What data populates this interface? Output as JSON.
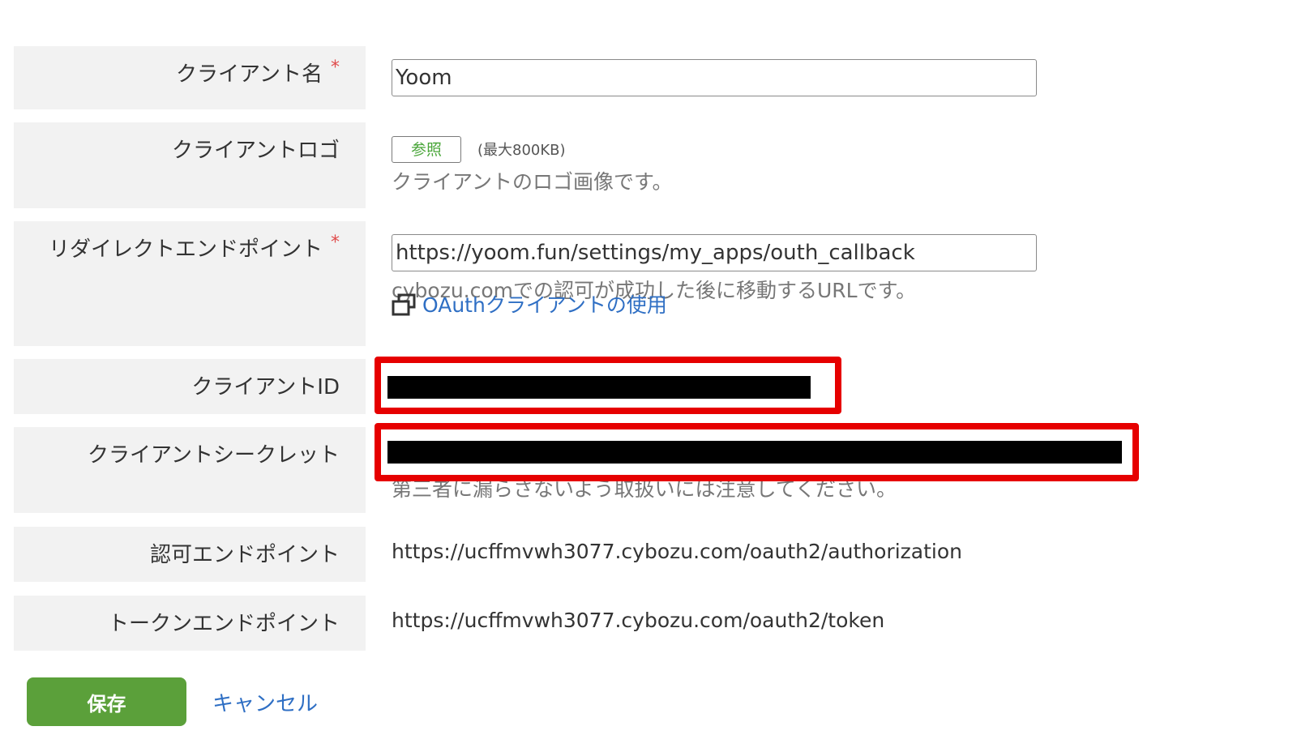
{
  "form": {
    "client_name": {
      "label": "クライアント名",
      "required_mark": "*",
      "value": "Yoom"
    },
    "client_logo": {
      "label": "クライアントロゴ",
      "browse_label": "参照",
      "max_size": "(最大800KB)",
      "hint": "クライアントのロゴ画像です。"
    },
    "redirect_endpoint": {
      "label": "リダイレクトエンドポイント",
      "required_mark": "*",
      "value": "https://yoom.fun/settings/my_apps/outh_callback",
      "hint": "cybozu.comでの認可が成功した後に移動するURLです。",
      "help_link": "OAuthクライアントの使用"
    },
    "client_id": {
      "label": "クライアントID"
    },
    "client_secret": {
      "label": "クライアントシークレット",
      "hint": "第三者に漏らさないよう取扱いには注意してください。"
    },
    "auth_endpoint": {
      "label": "認可エンドポイント",
      "value": "https://ucffmvwh3077.cybozu.com/oauth2/authorization"
    },
    "token_endpoint": {
      "label": "トークンエンドポイント",
      "value": "https://ucffmvwh3077.cybozu.com/oauth2/token"
    }
  },
  "actions": {
    "save_label": "保存",
    "cancel_label": "キャンセル"
  },
  "colors": {
    "save_button": "#5ba03a",
    "link": "#2f6fc4",
    "highlight_box": "#e60000",
    "required_mark": "#e04b4b"
  }
}
